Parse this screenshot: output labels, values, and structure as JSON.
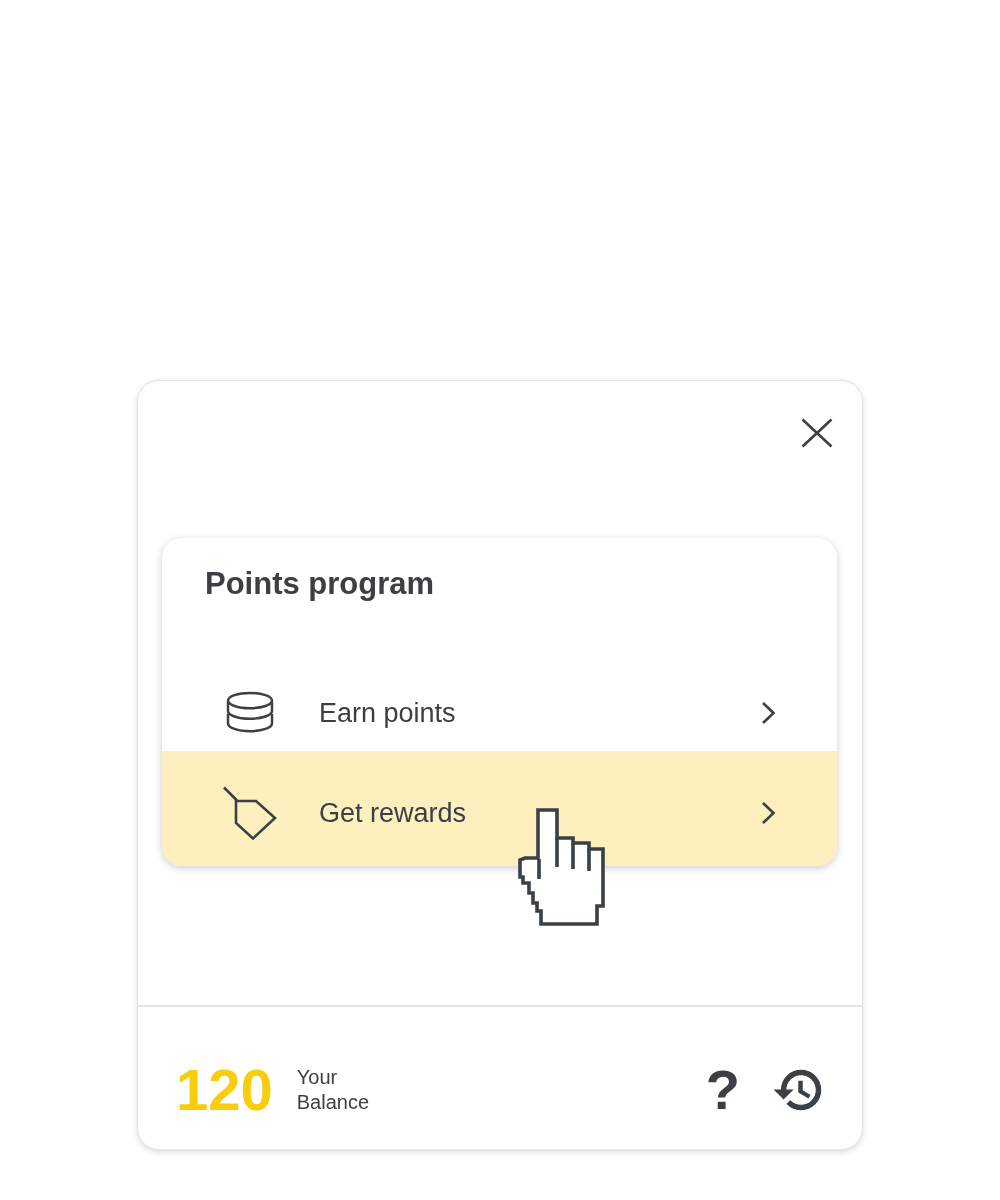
{
  "menu": {
    "title": "Points program",
    "items": [
      {
        "label": "Earn points",
        "kind": "coins",
        "selected": false
      },
      {
        "label": "Get rewards",
        "kind": "tag",
        "selected": true
      }
    ]
  },
  "footer": {
    "balance": "120",
    "balance_label": "Your Balance",
    "help": "?"
  }
}
